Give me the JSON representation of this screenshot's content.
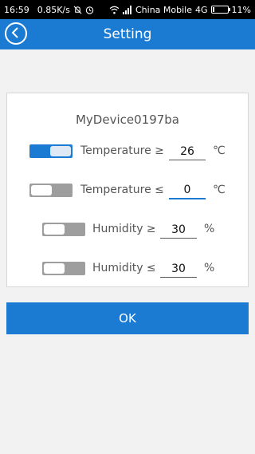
{
  "status_bar": {
    "time": "16:59",
    "speed": "0.85K/s",
    "carrier": "China Mobile",
    "network": "4G",
    "battery": "11%",
    "battery_level": 0.11,
    "icons": [
      "mute-icon",
      "alarm-icon",
      "wifi-icon",
      "signal-icon",
      "battery-icon"
    ]
  },
  "app_bar": {
    "title": "Setting",
    "back_icon": "chevron-left-icon",
    "color": "#1b7bd3"
  },
  "card": {
    "device_name": "MyDevice0197ba",
    "rows": [
      {
        "label": "Temperature ≥",
        "value": "26",
        "unit": "℃",
        "enabled": true
      },
      {
        "label": "Temperature ≤",
        "value": "0",
        "unit": "℃",
        "enabled": false
      },
      {
        "label": "Humidity ≥",
        "value": "30",
        "unit": "%",
        "enabled": false
      },
      {
        "label": "Humidity ≤",
        "value": "30",
        "unit": "%",
        "enabled": false
      }
    ]
  },
  "ok_button": {
    "label": "OK"
  }
}
